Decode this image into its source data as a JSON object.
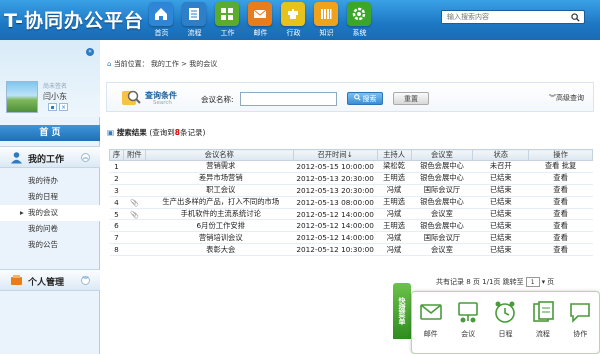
{
  "app": {
    "title": "T-协同办公平台"
  },
  "nav": {
    "items": [
      {
        "label": "首页",
        "icon": "home-icon",
        "color": "#2f86d6"
      },
      {
        "label": "流程",
        "icon": "flow-icon",
        "color": "#2d7fc9"
      },
      {
        "label": "工作",
        "icon": "work-icon",
        "color": "#5aab2e"
      },
      {
        "label": "邮件",
        "icon": "mail-icon",
        "color": "#e87d1e"
      },
      {
        "label": "行政",
        "icon": "admin-icon",
        "color": "#e6c21a"
      },
      {
        "label": "知识",
        "icon": "knowledge-icon",
        "color": "#f0a21a"
      },
      {
        "label": "系统",
        "icon": "system-icon",
        "color": "#3ca62a"
      }
    ]
  },
  "search": {
    "placeholder": "输入搜索内容"
  },
  "sidebar": {
    "signature": "尚未签名",
    "username": "闫小东",
    "home": "首  页",
    "sections": [
      {
        "label": "我的工作",
        "items": [
          "我的待办",
          "我的日程",
          "我的会议",
          "我的问卷",
          "我的公告"
        ]
      },
      {
        "label": "个人管理",
        "items": []
      }
    ]
  },
  "main": {
    "breadcrumb": "当前位置： 我的工作 > 我的会议",
    "query": {
      "title": "查询条件",
      "subtitle": "Search",
      "field_label": "会议名称:",
      "search_btn": "搜索",
      "reset_btn": "重置",
      "advanced": "高级查询"
    },
    "results": {
      "title": "搜索结果",
      "prefix": "(查询到",
      "count": "8",
      "suffix": "条记录)"
    },
    "table": {
      "headers": [
        "序",
        "附件",
        "会议名称",
        "召开时间↓",
        "主持人",
        "会议室",
        "状态",
        "操作"
      ],
      "rows": [
        {
          "no": "1",
          "attach": "",
          "name": "营销需求",
          "time": "2012-05-15 10:00:00",
          "host": "梁松乾",
          "room": "银色会展中心",
          "status": "未召开",
          "ops": "查看 批复"
        },
        {
          "no": "2",
          "attach": "",
          "name": "差异市场营销",
          "time": "2012-05-13 20:30:00",
          "host": "王明选",
          "room": "银色会展中心",
          "status": "已结束",
          "ops": "查看"
        },
        {
          "no": "3",
          "attach": "",
          "name": "职工会议",
          "time": "2012-05-13 20:30:00",
          "host": "冯斌",
          "room": "国际会议厅",
          "status": "已结束",
          "ops": "查看"
        },
        {
          "no": "4",
          "attach": "clip",
          "name": "生产出多样的产品，打入不同的市场",
          "time": "2012-05-13 08:00:00",
          "host": "王明选",
          "room": "银色会展中心",
          "status": "已结束",
          "ops": "查看"
        },
        {
          "no": "5",
          "attach": "clip",
          "name": "手机软件的主流系统讨论",
          "time": "2012-05-12 14:00:00",
          "host": "冯斌",
          "room": "会议室",
          "status": "已结束",
          "ops": "查看"
        },
        {
          "no": "6",
          "attach": "",
          "name": "6月份工作安排",
          "time": "2012-05-12 14:00:00",
          "host": "王明选",
          "room": "银色会展中心",
          "status": "已结束",
          "ops": "查看"
        },
        {
          "no": "7",
          "attach": "",
          "name": "营销培训会议",
          "time": "2012-05-12 14:00:00",
          "host": "冯斌",
          "room": "国际会议厅",
          "status": "已结束",
          "ops": "查看"
        },
        {
          "no": "8",
          "attach": "",
          "name": "表彰大会",
          "time": "2012-05-12 10:30:00",
          "host": "冯斌",
          "room": "会议室",
          "status": "已结束",
          "ops": "查看"
        }
      ]
    },
    "pager": {
      "summary": "共有记录 8 页  1/1页  跳转至",
      "page": "1",
      "suffix": "页"
    }
  },
  "quick": {
    "tab": "快捷菜单",
    "items": [
      {
        "label": "邮件",
        "icon": "mail-icon"
      },
      {
        "label": "会议",
        "icon": "meeting-icon"
      },
      {
        "label": "日程",
        "icon": "clock-icon"
      },
      {
        "label": "流程",
        "icon": "flow-icon"
      },
      {
        "label": "协作",
        "icon": "chat-icon"
      }
    ]
  },
  "colors": {
    "header": "#1d78c4",
    "accent": "#d00000",
    "quick": "#2f8d1f"
  }
}
